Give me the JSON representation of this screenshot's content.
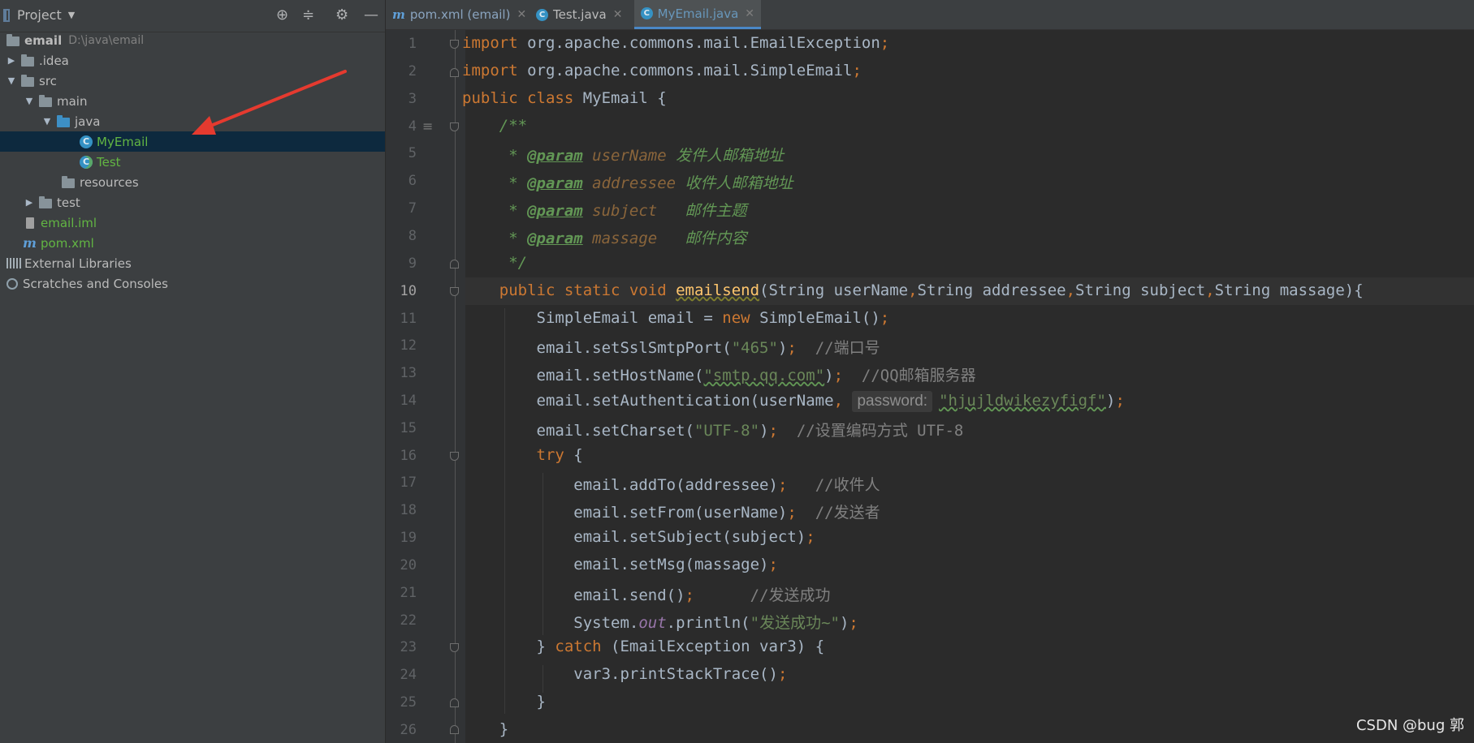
{
  "project_panel": {
    "title": "Project",
    "tree": [
      {
        "label": "email",
        "path": "D:\\java\\email",
        "kind": "module"
      },
      {
        "label": ".idea",
        "kind": "folder"
      },
      {
        "label": "src",
        "kind": "folder"
      },
      {
        "label": "main",
        "kind": "folder"
      },
      {
        "label": "java",
        "kind": "source-folder"
      },
      {
        "label": "MyEmail",
        "kind": "class",
        "selected": true
      },
      {
        "label": "Test",
        "kind": "class"
      },
      {
        "label": "resources",
        "kind": "resources-folder"
      },
      {
        "label": "test",
        "kind": "folder"
      },
      {
        "label": "email.iml",
        "kind": "iml"
      },
      {
        "label": "pom.xml",
        "kind": "maven"
      },
      {
        "label": "External Libraries",
        "kind": "libraries"
      },
      {
        "label": "Scratches and Consoles",
        "kind": "scratches"
      }
    ]
  },
  "tabs": [
    {
      "label": "pom.xml (email)",
      "icon": "maven-icon"
    },
    {
      "label": "Test.java",
      "icon": "class-icon"
    },
    {
      "label": "MyEmail.java",
      "icon": "class-icon",
      "active": true
    }
  ],
  "editor": {
    "current_line": 10,
    "line_numbers": [
      "1",
      "2",
      "3",
      "4",
      "5",
      "6",
      "7",
      "8",
      "9",
      "10",
      "11",
      "12",
      "13",
      "14",
      "15",
      "16",
      "17",
      "18",
      "19",
      "20",
      "21",
      "22",
      "23",
      "24",
      "25",
      "26"
    ],
    "lines": {
      "l1": {
        "a": "import",
        "b": " org.apache.commons.mail.EmailException",
        "c": ";"
      },
      "l2": {
        "a": "import",
        "b": " org.apache.commons.mail.SimpleEmail",
        "c": ";"
      },
      "l3": {
        "a": "public class",
        "b": " MyEmail {"
      },
      "l4": {
        "a": "    /**"
      },
      "l5": {
        "a": "     * ",
        "tag": "@param",
        "p": " userName",
        "d": " 发件人邮箱地址"
      },
      "l6": {
        "a": "     * ",
        "tag": "@param",
        "p": " addressee",
        "d": " 收件人邮箱地址"
      },
      "l7": {
        "a": "     * ",
        "tag": "@param",
        "p": " subject",
        "d": "   邮件主题"
      },
      "l8": {
        "a": "     * ",
        "tag": "@param",
        "p": " massage",
        "d": "   邮件内容"
      },
      "l9": {
        "a": "     */"
      },
      "l10": {
        "kw": "    public static void ",
        "fn": "emailsend",
        "b": "(String userName",
        "c1": ",",
        "d": "String addressee",
        "c2": ",",
        "e": "String subject",
        "c3": ",",
        "f": "String massage){"
      },
      "l11": {
        "a": "        SimpleEmail email = ",
        "kw": "new",
        "b": " SimpleEmail()",
        "c": ";"
      },
      "l12": {
        "a": "        email.setSslSmtpPort(",
        "s": "\"465\"",
        "b": ")",
        "c": ";",
        "lc": "  //端口号"
      },
      "l13": {
        "a": "        email.setHostName(",
        "s": "\"smtp.qq.com\"",
        "b": ")",
        "c": ";",
        "lc": "  //QQ邮箱服务器"
      },
      "l14": {
        "a": "        email.setAuthentication(userName",
        "c1": ",",
        "hint": "password:",
        "s": "\"hjujldwikezyfigf\"",
        "b": ")",
        "c": ";"
      },
      "l15": {
        "a": "        email.setCharset(",
        "s": "\"UTF-8\"",
        "b": ")",
        "c": ";",
        "lc": "  //设置编码方式 UTF-8"
      },
      "l16": {
        "kw": "        try",
        "b": " {"
      },
      "l17": {
        "a": "            email.addTo(addressee)",
        "c": ";",
        "lc": "   //收件人"
      },
      "l18": {
        "a": "            email.setFrom(userName)",
        "c": ";",
        "lc": "  //发送者"
      },
      "l19": {
        "a": "            email.setSubject(subject)",
        "c": ";"
      },
      "l20": {
        "a": "            email.setMsg(massage)",
        "c": ";"
      },
      "l21": {
        "a": "            email.send()",
        "c": ";",
        "lc": "      //发送成功"
      },
      "l22": {
        "a": "            System.",
        "fld": "out",
        "b": ".println(",
        "s": "\"发送成功~\"",
        "e": ")",
        "c": ";"
      },
      "l23": {
        "a": "        } ",
        "kw": "catch",
        "b": " (EmailException var3) {"
      },
      "l24": {
        "a": "            var3.printStackTrace()",
        "c": ";"
      },
      "l25": {
        "a": "        }"
      },
      "l26": {
        "a": "    }"
      }
    }
  },
  "watermark": "CSDN @bug 郭",
  "colors": {
    "keyword": "#cc7832",
    "string": "#6a8759",
    "comment": "#808080",
    "doc": "#629755",
    "selection": "#0d293e",
    "arrow": "#e53a2f"
  }
}
